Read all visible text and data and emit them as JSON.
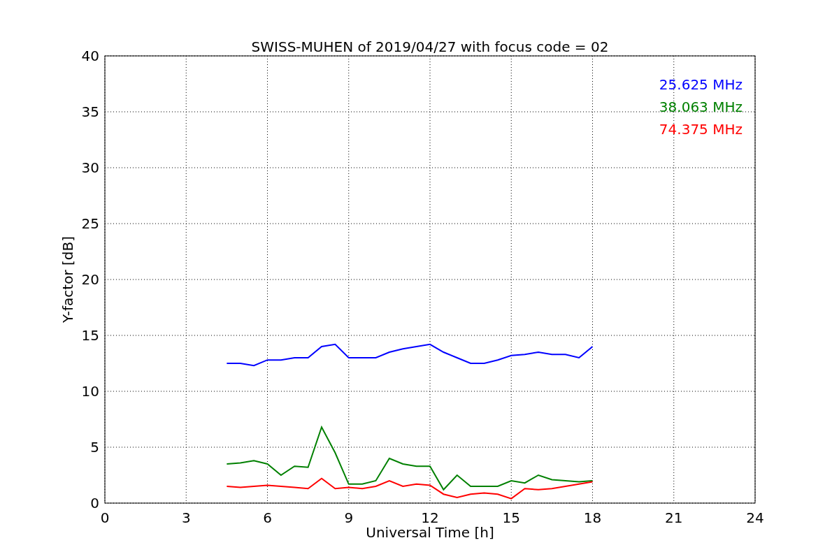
{
  "figure": {
    "chart_data": {
      "type": "line",
      "title": "SWISS-MUHEN of 2019/04/27 with focus code = 02",
      "xlabel": "Universal Time [h]",
      "ylabel": "Y-factor [dB]",
      "x": [
        4.5,
        5,
        5.5,
        6,
        6.5,
        7,
        7.5,
        8,
        8.5,
        9,
        9.5,
        10,
        10.5,
        11,
        11.5,
        12,
        12.5,
        13,
        13.5,
        14,
        14.5,
        15,
        15.5,
        16,
        16.5,
        17,
        17.5,
        18
      ],
      "series": [
        {
          "name": "25.625 MHz",
          "color": "#0000ff",
          "values": [
            12.5,
            12.5,
            12.3,
            12.8,
            12.8,
            13,
            13,
            14,
            14.2,
            13,
            13,
            13,
            13.5,
            13.8,
            14,
            14.2,
            13.5,
            13,
            12.5,
            12.5,
            12.8,
            13.2,
            13.3,
            13.5,
            13.3,
            13.3,
            13,
            14
          ]
        },
        {
          "name": "38.063 MHz",
          "color": "#008000",
          "values": [
            3.5,
            3.6,
            3.8,
            3.5,
            2.5,
            3.3,
            3.2,
            6.8,
            4.5,
            1.7,
            1.7,
            2,
            4,
            3.5,
            3.3,
            3.3,
            1.2,
            2.5,
            1.5,
            1.5,
            1.5,
            2,
            1.8,
            2.5,
            2.1,
            2,
            1.9,
            2
          ]
        },
        {
          "name": "74.375 MHz",
          "color": "#ff0000",
          "values": [
            1.5,
            1.4,
            1.5,
            1.6,
            1.5,
            1.4,
            1.3,
            2.2,
            1.3,
            1.4,
            1.3,
            1.5,
            2,
            1.5,
            1.7,
            1.6,
            0.8,
            0.5,
            0.8,
            0.9,
            0.8,
            0.4,
            1.3,
            1.2,
            1.3,
            1.5,
            1.7,
            1.9
          ]
        }
      ],
      "grid": true,
      "xlim": [
        0,
        24
      ],
      "ylim": [
        0,
        40
      ],
      "xticks": [
        0,
        3,
        6,
        9,
        12,
        15,
        18,
        21,
        24
      ],
      "yticks": [
        0,
        5,
        10,
        15,
        20,
        25,
        30,
        35,
        40
      ]
    }
  }
}
